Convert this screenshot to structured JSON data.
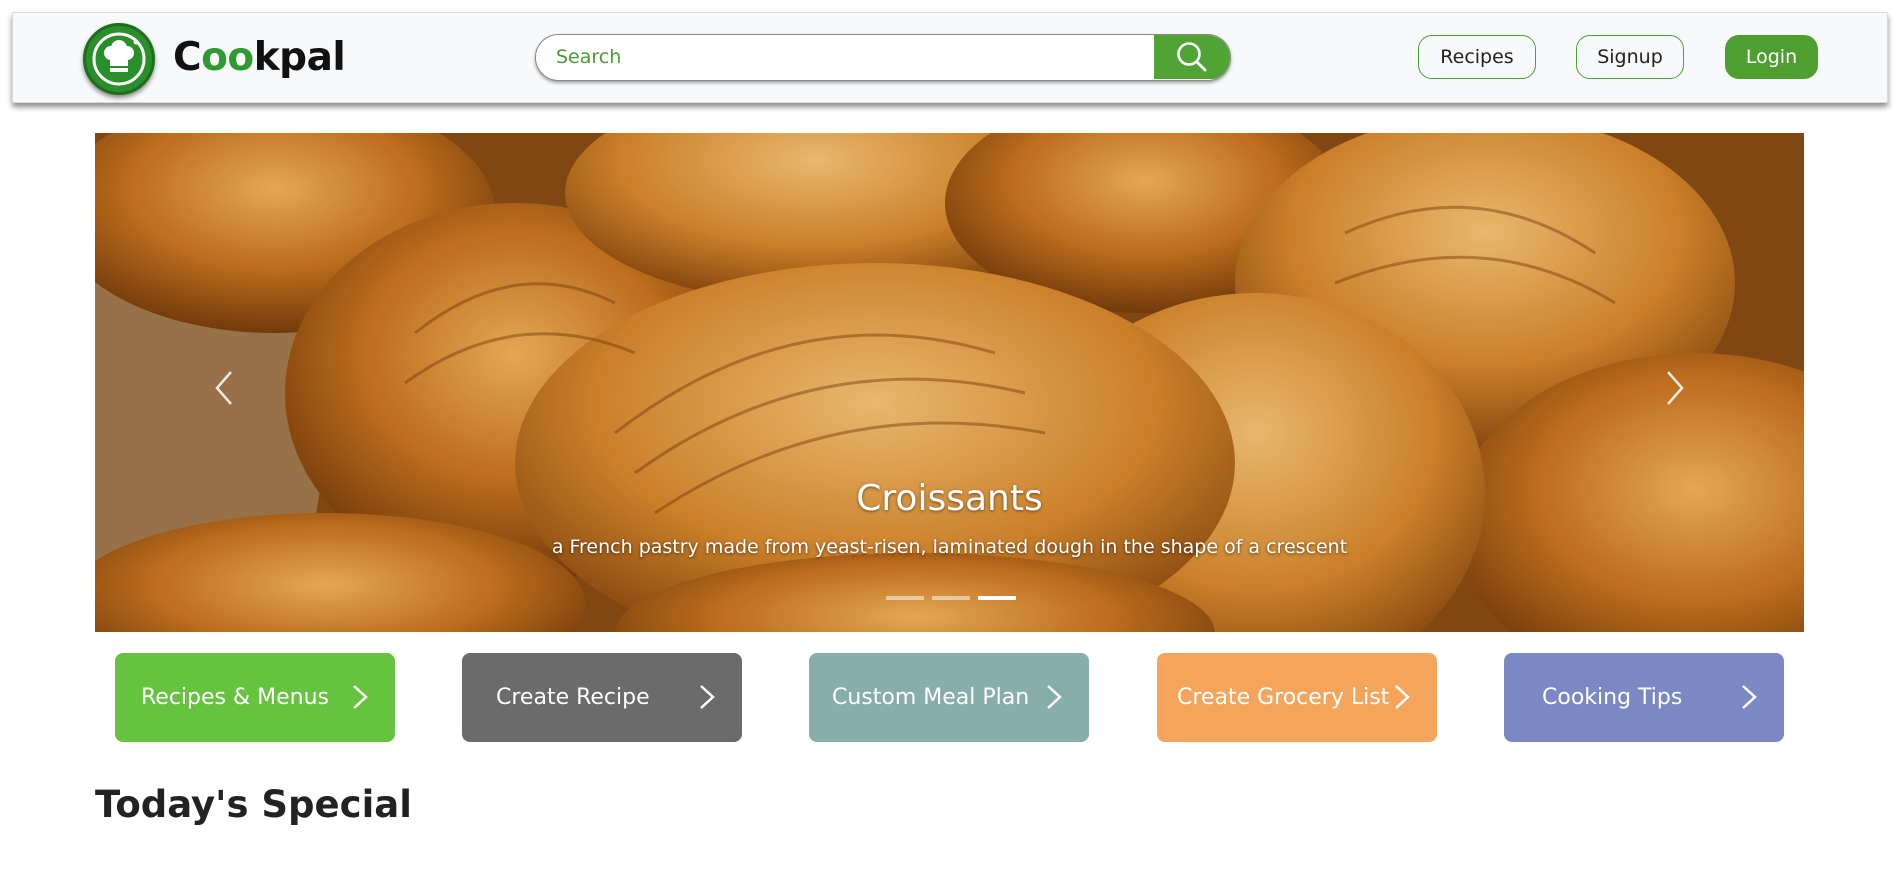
{
  "header": {
    "brand": {
      "part1": "C",
      "part2": "oo",
      "part3": "kpal"
    },
    "search": {
      "placeholder": "Search"
    },
    "nav": {
      "recipes": "Recipes",
      "signup": "Signup",
      "login": "Login"
    }
  },
  "carousel": {
    "title": "Croissants",
    "description": "a French pastry made from yeast-risen, laminated dough in the shape of a crescent",
    "active_index": 2,
    "slide_count": 3
  },
  "tiles": [
    {
      "label": "Recipes & Menus",
      "color": "#66c340"
    },
    {
      "label": "Create Recipe",
      "color": "#6b6b6b"
    },
    {
      "label": "Custom Meal Plan",
      "color": "#87aeaa"
    },
    {
      "label": "Create Grocery List",
      "color": "#f4a55b"
    },
    {
      "label": "Cooking Tips",
      "color": "#7c88c3"
    }
  ],
  "sections": {
    "todays_special": "Today's Special"
  },
  "colors": {
    "brand_green": "#4f9f30",
    "logo_green": "#2a8f2a"
  },
  "icons": {
    "search": "search-icon",
    "logo": "chef-hat-icon",
    "prev": "chevron-left-icon",
    "next": "chevron-right-icon"
  }
}
